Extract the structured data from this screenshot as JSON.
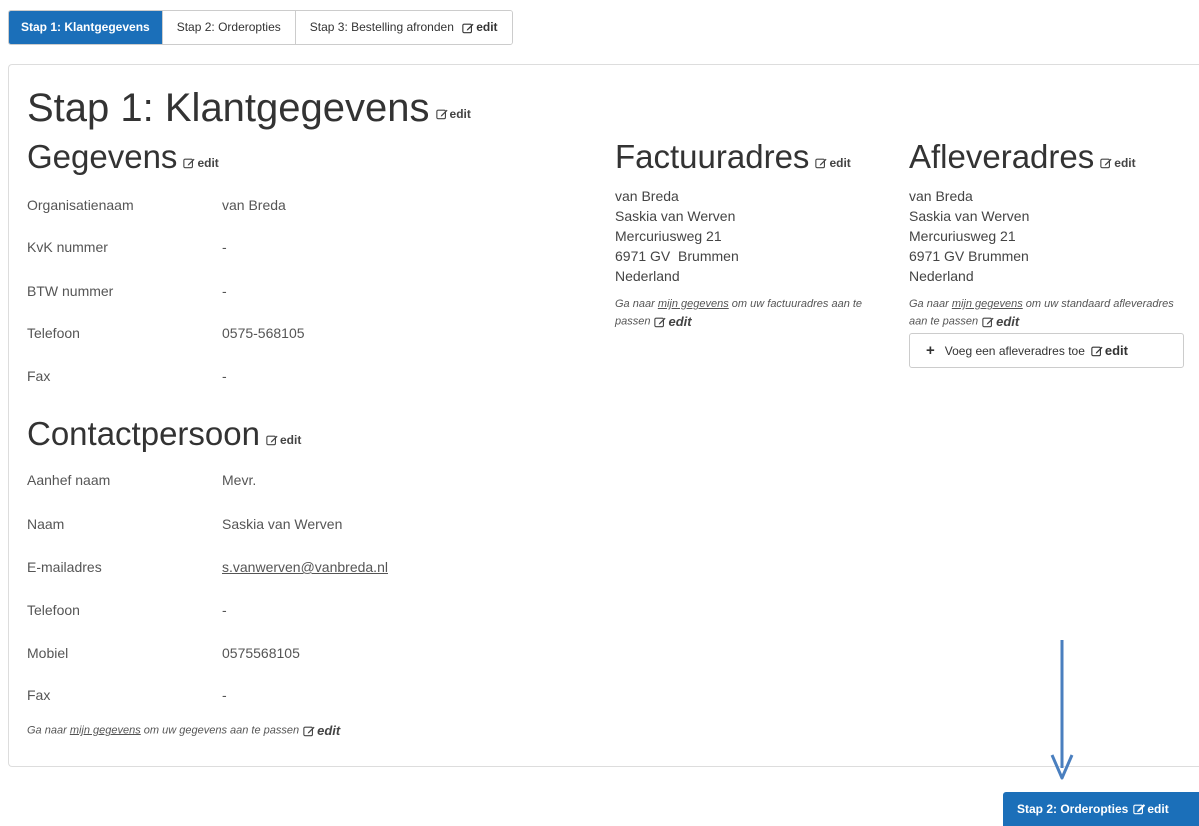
{
  "tabs": [
    {
      "label": "Stap 1: Klantgegevens"
    },
    {
      "label": "Stap 2: Orderopties"
    },
    {
      "label": "Stap 3: Bestelling afronden"
    }
  ],
  "edit_label": "edit",
  "page_title": "Stap 1: Klantgegevens",
  "gegevens": {
    "title": "Gegevens",
    "rows": [
      {
        "label": "Organisatienaam",
        "value": "van Breda"
      },
      {
        "label": "KvK nummer",
        "value": "-"
      },
      {
        "label": "BTW nummer",
        "value": "-"
      },
      {
        "label": "Telefoon",
        "value": "0575-568105"
      },
      {
        "label": "Fax",
        "value": "-"
      }
    ]
  },
  "contact": {
    "title": "Contactpersoon",
    "rows": [
      {
        "label": "Aanhef naam",
        "value": "Mevr."
      },
      {
        "label": "Naam",
        "value": "Saskia van Werven"
      },
      {
        "label": "E-mailadres",
        "value": "s.vanwerven@vanbreda.nl"
      },
      {
        "label": "Telefoon",
        "value": "-"
      },
      {
        "label": "Mobiel",
        "value": "0575568105"
      },
      {
        "label": "Fax",
        "value": "-"
      }
    ],
    "note_pre": "Ga naar ",
    "note_link": "mijn gegevens",
    "note_post": " om uw gegevens aan te passen"
  },
  "factuur": {
    "title": "Factuuradres",
    "lines": [
      "van Breda",
      "Saskia van Werven",
      "Mercuriusweg 21",
      "6971 GV  Brummen",
      "Nederland"
    ],
    "note_pre": "Ga naar ",
    "note_link": "mijn gegevens",
    "note_post": " om uw factuuradres aan te passen"
  },
  "aflever": {
    "title": "Afleveradres",
    "lines": [
      "van Breda",
      "Saskia van Werven",
      "Mercuriusweg 21",
      "6971 GV Brummen",
      "Nederland"
    ],
    "note_pre": "Ga naar ",
    "note_link": "mijn gegevens",
    "note_post": " om uw standaard afleveradres aan te passen",
    "add_label": "Voeg een afleveradres toe"
  },
  "next_button": "Stap 2: Orderopties",
  "colors": {
    "primary": "#1b6fb9",
    "annotation_arrow": "#4a7fbf"
  }
}
